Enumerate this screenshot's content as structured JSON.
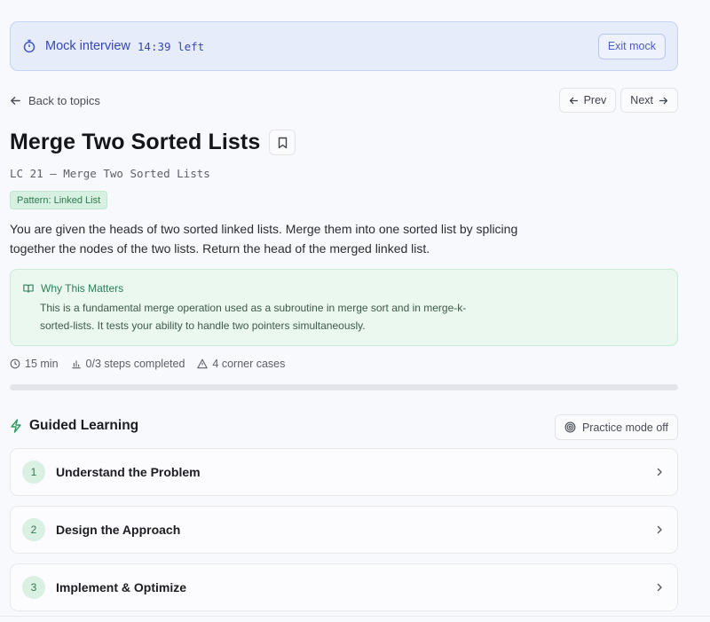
{
  "mock": {
    "label": "Mock interview",
    "time": "14:39 left",
    "exit_label": "Exit mock",
    "color": "#3548b0"
  },
  "nav": {
    "back_label": "Back to topics",
    "prev_label": "Prev",
    "next_label": "Next"
  },
  "problem": {
    "title": "Merge Two Sorted Lists",
    "subtitle": "LC 21 — Merge Two Sorted Lists",
    "pattern": "Pattern: Linked List",
    "description": "You are given the heads of two sorted linked lists. Merge them into one sorted list by splicing together the nodes of the two lists. Return the head of the merged linked list."
  },
  "why": {
    "heading": "Why This Matters",
    "text": "This is a fundamental merge operation used as a subroutine in merge sort and in merge-k-sorted-lists. It tests your ability to handle two pointers simultaneously."
  },
  "meta": {
    "time": "15 min",
    "steps": "0/3 steps completed",
    "corner_cases": "4 corner cases",
    "progress": 0
  },
  "guided": {
    "title": "Guided Learning",
    "practice_label": "Practice mode off",
    "steps": [
      {
        "num": "1",
        "label": "Understand the Problem"
      },
      {
        "num": "2",
        "label": "Design the Approach"
      },
      {
        "num": "3",
        "label": "Implement & Optimize"
      }
    ]
  },
  "colors": {
    "accent_green": "#2f7a4e",
    "mock_bg": "#e7ecfb"
  }
}
